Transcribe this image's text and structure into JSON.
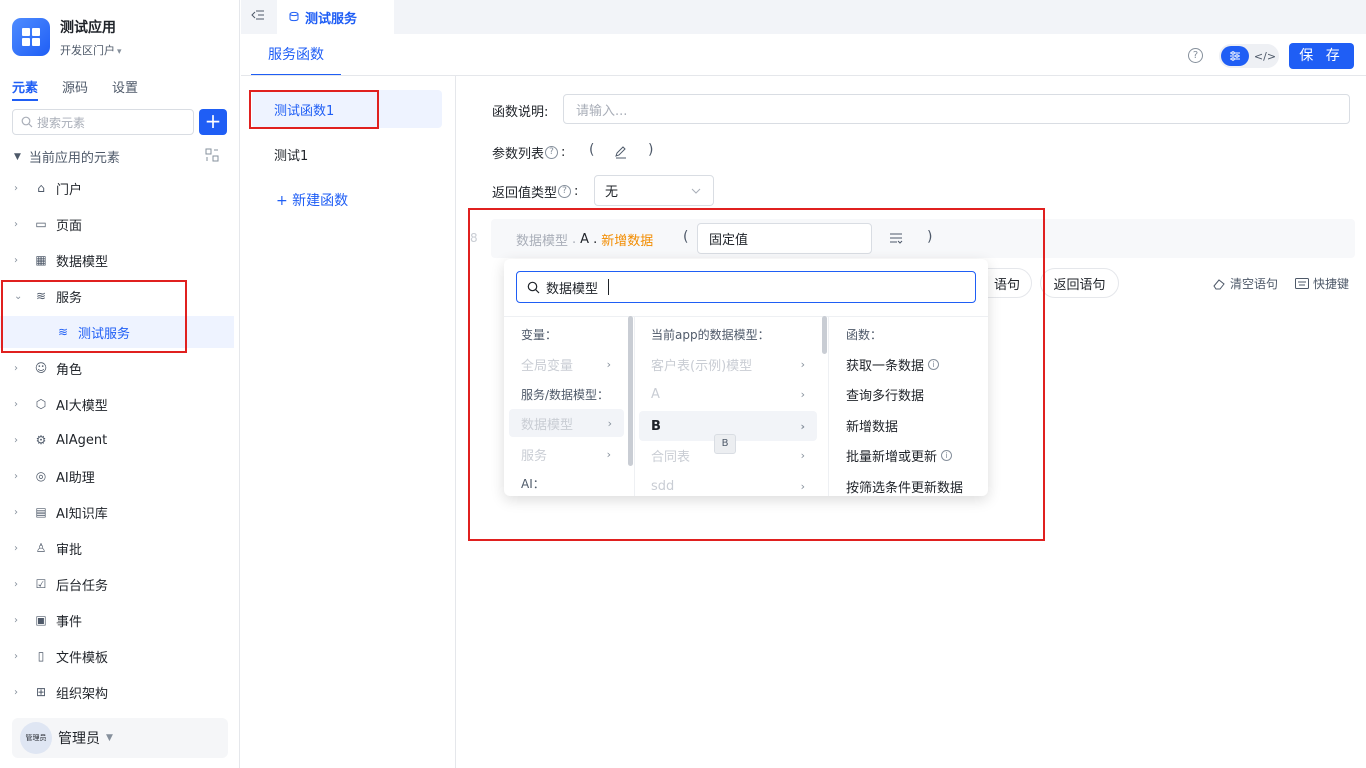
{
  "app": {
    "title": "测试应用",
    "portal": "开发区门户",
    "portal_caret": "▾"
  },
  "nav_tabs": [
    "元素",
    "源码",
    "设置"
  ],
  "search": {
    "placeholder": "搜索元素"
  },
  "add_label": "+",
  "tree": {
    "root_label": "当前应用的元素",
    "items": [
      {
        "label": "门户",
        "icon": "home-icon"
      },
      {
        "label": "页面",
        "icon": "page-icon"
      },
      {
        "label": "数据模型",
        "icon": "table-icon"
      },
      {
        "label": "服务",
        "icon": "service-icon",
        "expanded": true
      },
      {
        "label": "测试服务",
        "icon": "service-icon",
        "child": true
      },
      {
        "label": "角色",
        "icon": "role-icon"
      },
      {
        "label": "AI大模型",
        "icon": "cube-icon"
      },
      {
        "label": "AIAgent",
        "icon": "robot-icon"
      },
      {
        "label": "AI助理",
        "icon": "ai-assistant-icon"
      },
      {
        "label": "AI知识库",
        "icon": "book-icon"
      },
      {
        "label": "审批",
        "icon": "stamp-icon"
      },
      {
        "label": "后台任务",
        "icon": "task-icon"
      },
      {
        "label": "事件",
        "icon": "event-icon"
      },
      {
        "label": "文件模板",
        "icon": "file-icon"
      },
      {
        "label": "组织架构",
        "icon": "org-icon"
      }
    ]
  },
  "user": {
    "name": "管理员",
    "avatar_text": "管理员"
  },
  "top_tab": {
    "label": "测试服务"
  },
  "sub_tab": {
    "label": "服务函数"
  },
  "toolbar": {
    "save_label": "保 存",
    "help": "?"
  },
  "functions": {
    "items": [
      "测试函数1",
      "测试1"
    ],
    "active_index": 0,
    "new_label": "+ 新建函数"
  },
  "form": {
    "desc_label": "函数说明:",
    "desc_placeholder": "请输入...",
    "params_label": "参数列表",
    "params_open": "(",
    "params_close": ")",
    "return_label": "返回值类型",
    "return_value": "无",
    "colon": ":"
  },
  "code": {
    "line_no": "8",
    "part1": "数据模型",
    "dot": ".",
    "part2": "A",
    "method": "新增数据",
    "open": "(",
    "arg": "固定值",
    "close": ")"
  },
  "actions": {
    "stmt1": "语句",
    "stmt2": "返回语句",
    "clear": "清空语句",
    "shortcut": "快捷键"
  },
  "dropdown": {
    "query": "数据模型",
    "col1": {
      "head_vars": "变量：",
      "global_vars": "全局变量",
      "head_services": "服务/数据模型：",
      "data_model": "数据模型",
      "service": "服务",
      "head_ai": "AI："
    },
    "col2": {
      "head": "当前app的数据模型：",
      "items": [
        "客户表(示例)模型",
        "A",
        "B",
        "合同表",
        "sdd"
      ],
      "selected_index": 2
    },
    "col3": {
      "head": "函数：",
      "items": [
        {
          "label": "获取一条数据",
          "info": true
        },
        {
          "label": "查询多行数据",
          "info": false
        },
        {
          "label": "新增数据",
          "info": false
        },
        {
          "label": "批量新增或更新",
          "info": true
        },
        {
          "label": "按筛选条件更新数据",
          "info": false
        }
      ]
    },
    "tooltip": "B"
  },
  "colors": {
    "accent": "#1f5ef5",
    "highlight": "#e0201f",
    "method": "#f28c00"
  }
}
